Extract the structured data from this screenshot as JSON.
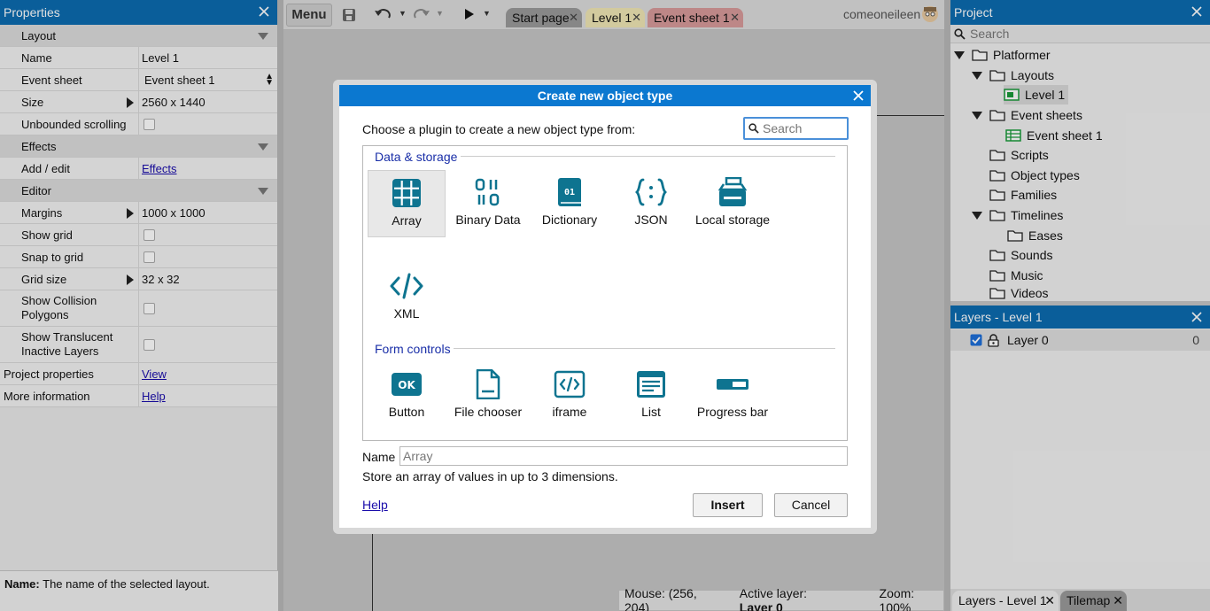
{
  "properties": {
    "title": "Properties",
    "rows": {
      "layout_cat": "Layout",
      "name_label": "Name",
      "name_value": "Level 1",
      "eventsheet_label": "Event sheet",
      "eventsheet_value": "Event sheet 1",
      "size_label": "Size",
      "size_value": "2560 x 1440",
      "unbounded_label": "Unbounded scrolling",
      "effects_cat": "Effects",
      "addedit_label": "Add / edit",
      "addedit_link": "Effects",
      "editor_cat": "Editor",
      "margins_label": "Margins",
      "margins_value": "1000 x 1000",
      "showgrid_label": "Show grid",
      "snap_label": "Snap to grid",
      "gridsize_label": "Grid size",
      "gridsize_value": "32 x 32",
      "collision_label": "Show Collision Polygons",
      "translucent_label": "Show Translucent Inactive Layers",
      "projprops_label": "Project properties",
      "projprops_link": "View",
      "moreinfo_label": "More information",
      "moreinfo_link": "Help"
    },
    "description_bold": "Name:",
    "description_text": " The name of the selected layout."
  },
  "toolbar": {
    "menu_label": "Menu",
    "tabs": [
      {
        "label": "Start page",
        "color": "#9a9a9a"
      },
      {
        "label": "Level 1",
        "color": "#efe6b4"
      },
      {
        "label": "Event sheet 1",
        "color": "#d89a9a"
      }
    ],
    "username": "comeoneileen"
  },
  "statusbar": {
    "mouse": "Mouse: (256, 204)",
    "active_layer_label": "Active layer:",
    "active_layer_value": "Layer 0",
    "zoom": "Zoom: 100%"
  },
  "project": {
    "title": "Project",
    "search_placeholder": "Search",
    "tree": {
      "root": "Platformer",
      "layouts": "Layouts",
      "level1": "Level 1",
      "eventsheets": "Event sheets",
      "eventsheet1": "Event sheet 1",
      "scripts": "Scripts",
      "objecttypes": "Object types",
      "families": "Families",
      "timelines": "Timelines",
      "eases": "Eases",
      "sounds": "Sounds",
      "music": "Music",
      "videos": "Videos"
    }
  },
  "layers": {
    "title": "Layers - Level 1",
    "layer_name": "Layer 0",
    "layer_index": "0",
    "bottom_tabs": [
      "Layers - Level 1",
      "Tilemap"
    ]
  },
  "dialog": {
    "title": "Create new object type",
    "prompt": "Choose a plugin to create a new object type from:",
    "search_placeholder": "Search",
    "categories": {
      "data": "Data & storage",
      "form": "Form controls"
    },
    "plugins": {
      "array": "Array",
      "binary": "Binary Data",
      "dictionary": "Dictionary",
      "json": "JSON",
      "localstorage": "Local storage",
      "xml": "XML",
      "button": "Button",
      "filechooser": "File chooser",
      "iframe": "iframe",
      "list": "List",
      "progressbar": "Progress bar"
    },
    "name_label": "Name",
    "name_value": "Array",
    "description": "Store an array of values in up to 3 dimensions.",
    "help_link": "Help",
    "insert_label": "Insert",
    "cancel_label": "Cancel"
  },
  "colors": {
    "accent_blue": "#0b78d0",
    "icon_teal": "#0e7490",
    "category_text": "#1a2fa8"
  }
}
